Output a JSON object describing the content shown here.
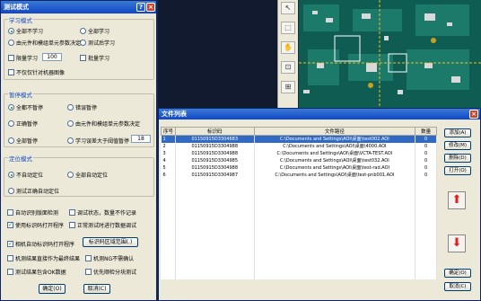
{
  "dialog": {
    "title": "测试模式",
    "learn_mode": {
      "title": "学习模式",
      "opt1": "全部不学习",
      "opt2": "全部学习",
      "opt3": "由元件和模组单元参数决定",
      "opt4": "测试后学习",
      "cb1": "限量学习",
      "cb1_value": "100",
      "cb2": "批量学习",
      "cb3": "不仅仅针对机器图像"
    },
    "pause_mode": {
      "title": "暂停模式",
      "opt1": "全都不暂停",
      "opt2": "错误暂停",
      "opt3": "正确暂停",
      "opt4": "由元件和模组单元参数决定",
      "opt5": "全部暂停",
      "opt6": "学习误差大于阈值暂停",
      "opt6_value": "18"
    },
    "locate_mode": {
      "title": "定位模式",
      "opt1": "不自动定位",
      "opt2": "全部自动定位",
      "opt3": "测试正确自动定位"
    },
    "checks": {
      "c1": "自动识别版面检测",
      "c2": "调试状态，数量不作记录",
      "c3": "使用标识码打开程序",
      "c4": "正常测试时进行数据调试",
      "c5": "相机自动标识码打开程序",
      "c6_button": "标识码区域范围(.)",
      "c7": "机测结果直接作为最终结果",
      "c8": "机测NG不需确认",
      "c9": "测试结果包含OK数据",
      "c10": "优先顺检分块测试"
    },
    "ok": "确定(O)",
    "cancel": "取消(C)"
  },
  "tools": [
    "cursor-icon",
    "select-icon",
    "hand-icon",
    "zoom-area-icon",
    "frame-icon"
  ],
  "file_list": {
    "title": "文件列表",
    "headers": [
      "序号",
      "标识码",
      "文件路径",
      "数量"
    ],
    "rows": [
      [
        "1",
        "01150915D3304683",
        "C:\\Documents and Settings\\AOI\\桌面\\test002.AOI",
        "0"
      ],
      [
        "2",
        "01150915D3304988",
        "C:\\Documents and Settings\\AOI\\桌面\\4000.AOI",
        "0"
      ],
      [
        "3",
        "01150915D3304988",
        "C:\\Documents and Settings\\AOI\\桌面\\VCTA-TEST.AOI",
        "0"
      ],
      [
        "4",
        "01150915D3304985",
        "C:\\Documents and Settings\\AOI\\桌面\\test032.AOI",
        "0"
      ],
      [
        "5",
        "01150915D3304988",
        "C:\\Documents and Settings\\AOI\\桌面\\test-rad.AOI",
        "0"
      ],
      [
        "6",
        "01150915D3304987",
        "C:\\Documents and Settings\\AOI\\桌面\\test-pnb001.AOI",
        "0"
      ]
    ],
    "add": "添加(A)",
    "modify": "修改(M)",
    "delete": "删除(D)",
    "open": "打开(O)",
    "ok": "确定(O)",
    "cancel": "取消(C)"
  },
  "colors": {
    "titlebar": "#1046c7",
    "selection": "#316ac5",
    "pcb": "#0f5d52"
  }
}
